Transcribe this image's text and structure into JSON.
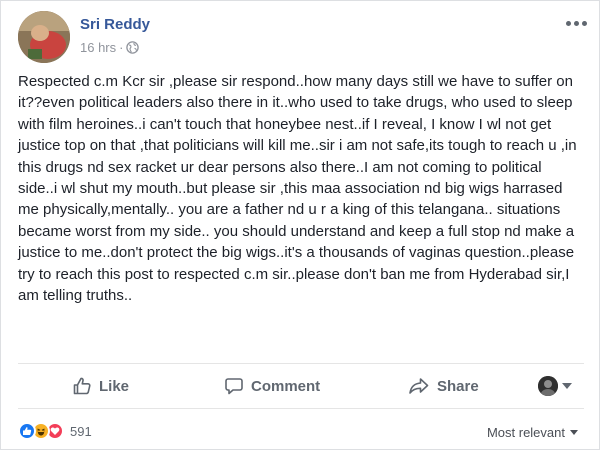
{
  "post": {
    "author": "Sri Reddy",
    "timestamp": "16 hrs",
    "meta_separator": "·",
    "privacy_icon": "globe-icon",
    "text": "Respected c.m Kcr sir ,please sir respond..how many days still we have to suffer on it??even political leaders also there in it..who used to take drugs, who used to sleep with film heroines..i can't touch that honeybee nest..if I reveal, I know I wl not get justice top on that ,that politicians will kill me..sir i am not safe,its tough to reach u ,in this drugs nd sex racket ur dear persons also there..I am not coming to political side..i wl shut my mouth..but please sir ,this maa association nd big wigs harrased me physically,mentally.. you are a father nd u r a king of this telangana.. situations became worst from my side.. you should understand and keep a full stop nd make a justice to me..don't protect the big wigs..it's a thousands of vaginas question..please try to reach this post to respected c.m sir..please don't ban me from Hyderabad sir,I am telling truths.."
  },
  "actions": {
    "like_label": "Like",
    "comment_label": "Comment",
    "share_label": "Share"
  },
  "reactions": {
    "types": [
      "like",
      "haha",
      "love"
    ],
    "count": "591"
  },
  "comments": {
    "sort_label": "Most relevant"
  },
  "colors": {
    "name": "#365899",
    "like": "#1877f2",
    "haha": "#f7b125",
    "love": "#f33e58"
  }
}
